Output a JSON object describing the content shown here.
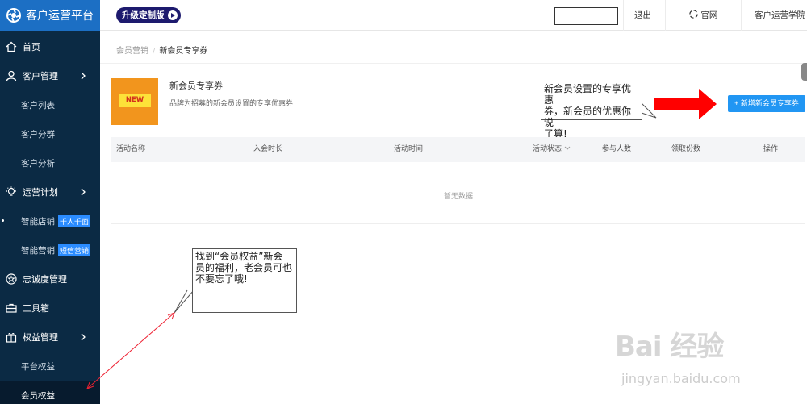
{
  "app": {
    "title": "客户运营平台"
  },
  "topbar": {
    "upgrade_label": "升级定制版",
    "logout": "退出",
    "official_site": "官网",
    "academy": "客户运营学院"
  },
  "sidebar": {
    "home": "首页",
    "customer_mgmt": "客户管理",
    "customer_list": "客户列表",
    "customer_group": "客户分群",
    "customer_analysis": "客户分析",
    "ops_plan": "运营计划",
    "smart_store": "智能店铺",
    "smart_store_tag": "千人千面",
    "smart_marketing": "智能营销",
    "smart_marketing_tag": "短信营销",
    "loyalty": "忠诚度管理",
    "toolbox": "工具箱",
    "benefits_mgmt": "权益管理",
    "platform_benefits": "平台权益",
    "member_benefits": "会员权益"
  },
  "breadcrumb": {
    "parent": "会员营销",
    "sep": "/",
    "current": "新会员专享券"
  },
  "card": {
    "image_text": "NEW",
    "title": "新会员专享券",
    "desc": "品牌为招募的新会员设置的专享优惠券"
  },
  "add_button": "+ 新增新会员专享券",
  "table": {
    "headers": [
      "活动名称",
      "入会时长",
      "活动时间",
      "活动状态",
      "参与人数",
      "领取份数",
      "操作"
    ],
    "empty_text": "暂无数据"
  },
  "callouts": {
    "top": [
      "新会员设置的专享优惠",
      "券，新会员的优惠你说",
      "了算!"
    ],
    "bottom": [
      "找到“会员权益”新会",
      "员的福利，老会员可也",
      "不要忘了哦!"
    ]
  },
  "watermark": {
    "brand": "Bai 经验",
    "url": "jingyan.baidu.com"
  },
  "colors": {
    "sidebar_bg": "#0b2a44",
    "brand_bg": "#1c6fc4",
    "primary": "#2196f3",
    "arrow_red": "#ff0000",
    "coupon_orange": "#f2951d"
  }
}
